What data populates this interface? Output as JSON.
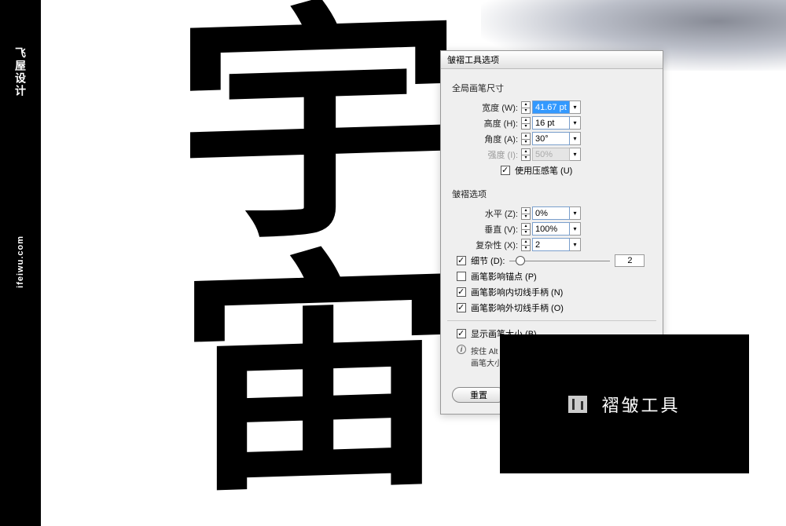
{
  "sidebar": {
    "brand": "飞屋设计",
    "url": "ifeiwu.com"
  },
  "canvas": {
    "text": "宇宙"
  },
  "dialog": {
    "title": "皱褶工具选项",
    "section_global": "全局画笔尺寸",
    "fields": {
      "width": {
        "label": "宽度 (W):",
        "value": "41.67 pt"
      },
      "height": {
        "label": "高度 (H):",
        "value": "16 pt"
      },
      "angle": {
        "label": "角度 (A):",
        "value": "30°"
      },
      "intensity": {
        "label": "强度 (I):",
        "value": "50%"
      }
    },
    "use_pressure": {
      "label": "使用压感笔 (U)",
      "checked": true
    },
    "section_wrinkle": "皱褶选项",
    "wrinkle_fields": {
      "horizontal": {
        "label": "水平 (Z):",
        "value": "0%"
      },
      "vertical": {
        "label": "垂直 (V):",
        "value": "100%"
      },
      "complexity": {
        "label": "复杂性 (X):",
        "value": "2"
      }
    },
    "detail": {
      "label": "细节 (D):",
      "checked": true,
      "value": "2"
    },
    "affect_anchor": {
      "label": "画笔影响锚点 (P)",
      "checked": false
    },
    "affect_in": {
      "label": "画笔影响内切线手柄 (N)",
      "checked": true
    },
    "affect_out": {
      "label": "画笔影响外切线手柄 (O)",
      "checked": true
    },
    "show_brush": {
      "label": "显示画笔大小 (B)",
      "checked": true
    },
    "hint": "按住 Alt 键，然后使用该工具单击，即可相应地更改画笔大小。",
    "reset_btn": "重置"
  },
  "tooltip": {
    "name": "褶皱工具"
  }
}
